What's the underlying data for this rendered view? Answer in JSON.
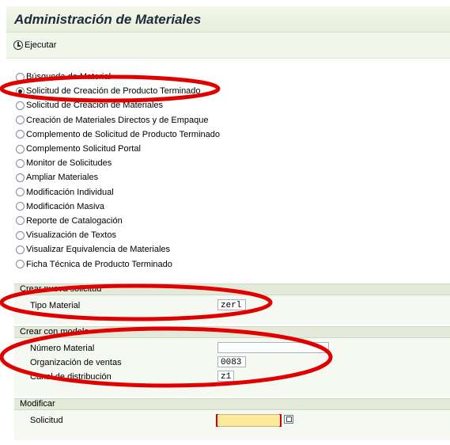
{
  "header": {
    "title": "Administración de Materiales"
  },
  "toolbar": {
    "execute_label": "Ejecutar"
  },
  "options": [
    {
      "label": "Búsqueda de Material",
      "checked": false
    },
    {
      "label": "Solicitud de Creación de Producto Terminado",
      "checked": true
    },
    {
      "label": "Solicitud de Creación de Materiales",
      "checked": false
    },
    {
      "label": "Creación de Materiales Directos y de Empaque",
      "checked": false
    },
    {
      "label": "Complemento de Solicitud de Producto Terminado",
      "checked": false
    },
    {
      "label": "Complemento Solicitud Portal",
      "checked": false
    },
    {
      "label": "Monitor de Solicitudes",
      "checked": false
    },
    {
      "label": "Ampliar Materiales",
      "checked": false
    },
    {
      "label": "Modificación Individual",
      "checked": false
    },
    {
      "label": "Modificación Masiva",
      "checked": false
    },
    {
      "label": "Reporte de Catalogación",
      "checked": false
    },
    {
      "label": "Visualización de Textos",
      "checked": false
    },
    {
      "label": "Visualizar Equivalencia de Materiales",
      "checked": false
    },
    {
      "label": "Ficha Técnica de Producto Terminado",
      "checked": false
    }
  ],
  "group_new": {
    "title": "Crear nueva solicitud",
    "tipo_material_label": "Tipo Material",
    "tipo_material_value": "zerl"
  },
  "group_model": {
    "title": "Crear con modelo",
    "numero_material_label": "Número Material",
    "numero_material_value": "",
    "org_ventas_label": "Organización de ventas",
    "org_ventas_value": "0083",
    "canal_label": "Canal de distribución",
    "canal_value": "z1"
  },
  "group_modify": {
    "title": "Modificar",
    "solicitud_label": "Solicitud",
    "solicitud_value": ""
  },
  "colors": {
    "annotation": "#e00000",
    "header_bg": "#e3ead9",
    "required_field": "#fde99c"
  }
}
